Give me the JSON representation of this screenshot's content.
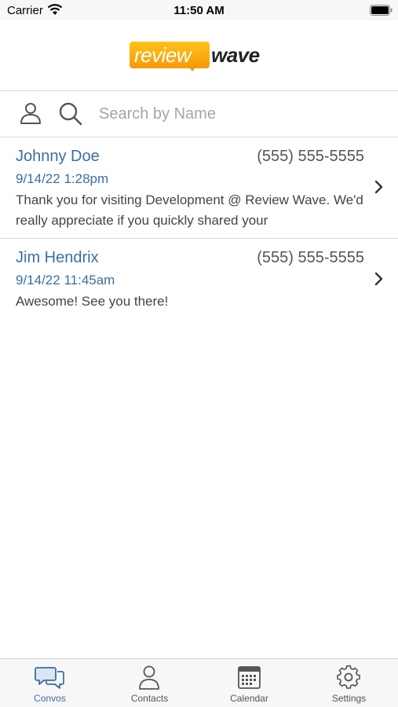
{
  "status_bar": {
    "carrier": "Carrier",
    "time": "11:50 AM"
  },
  "header": {
    "logo_left": "review",
    "logo_right": "wave"
  },
  "search": {
    "placeholder": "Search by Name",
    "value": ""
  },
  "conversations": [
    {
      "name": "Johnny Doe",
      "phone": "(555) 555-5555",
      "date": "9/14/22 1:28pm",
      "message": "Thank you for visiting Development @ Review Wave. We'd really appreciate if you quickly shared your"
    },
    {
      "name": "Jim Hendrix",
      "phone": "(555) 555-5555",
      "date": "9/14/22 11:45am",
      "message": "Awesome! See you there!"
    }
  ],
  "tabs": [
    {
      "label": "Convos",
      "icon": "chat-bubbles-icon",
      "active": true
    },
    {
      "label": "Contacts",
      "icon": "person-icon",
      "active": false
    },
    {
      "label": "Calendar",
      "icon": "calendar-icon",
      "active": false
    },
    {
      "label": "Settings",
      "icon": "gear-icon",
      "active": false
    }
  ],
  "colors": {
    "accent": "#3a6ea5",
    "logo_orange": "#f59a0a",
    "logo_yellow": "#ffc21a"
  }
}
